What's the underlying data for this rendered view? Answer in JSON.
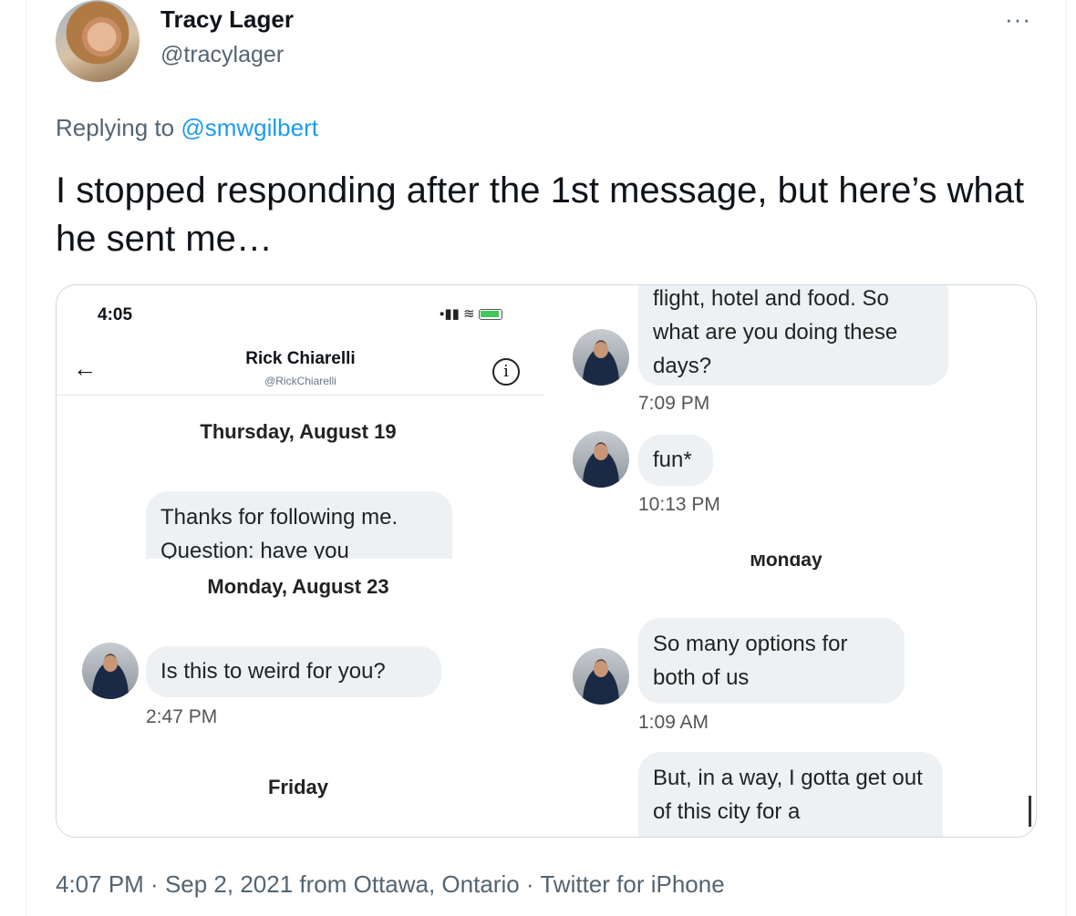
{
  "author": {
    "display_name": "Tracy Lager",
    "handle": "@tracylager"
  },
  "more_label": "···",
  "reply": {
    "prefix": "Replying to ",
    "to": "@smwgilbert"
  },
  "text": "I stopped responding after the 1st message, but here’s what he sent me…",
  "screenshot": {
    "status_time": "4:05",
    "contact_name": "Rick Chiarelli",
    "contact_handle": "@RickChiarelli",
    "left": {
      "date1": "Thursday, August 19",
      "bubble1": "Thanks for following me. Question: have you",
      "date2": "Monday, August 23",
      "bubble2": "Is this to weird for you?",
      "time2": "2:47 PM",
      "date3": "Friday"
    },
    "right": {
      "bubble1": "flight, hotel and food. So what are you doing these days?",
      "time1": "7:09 PM",
      "bubble2": "fun*",
      "time2": "10:13 PM",
      "date_partial": "Monday",
      "bubble3": "So many options for both of us",
      "time3": "1:09 AM",
      "bubble4": "But, in a way, I gotta get out of this city for a"
    }
  },
  "footer": {
    "time": "4:07 PM",
    "sep1": " · ",
    "date": "Sep 2, 2021",
    "location": " from Ottawa, Ontario",
    "sep2": " · ",
    "source": "Twitter for iPhone"
  },
  "colors": {
    "link": "#1d9bf0",
    "secondary_text": "#536471",
    "bubble": "#eef1f3"
  }
}
